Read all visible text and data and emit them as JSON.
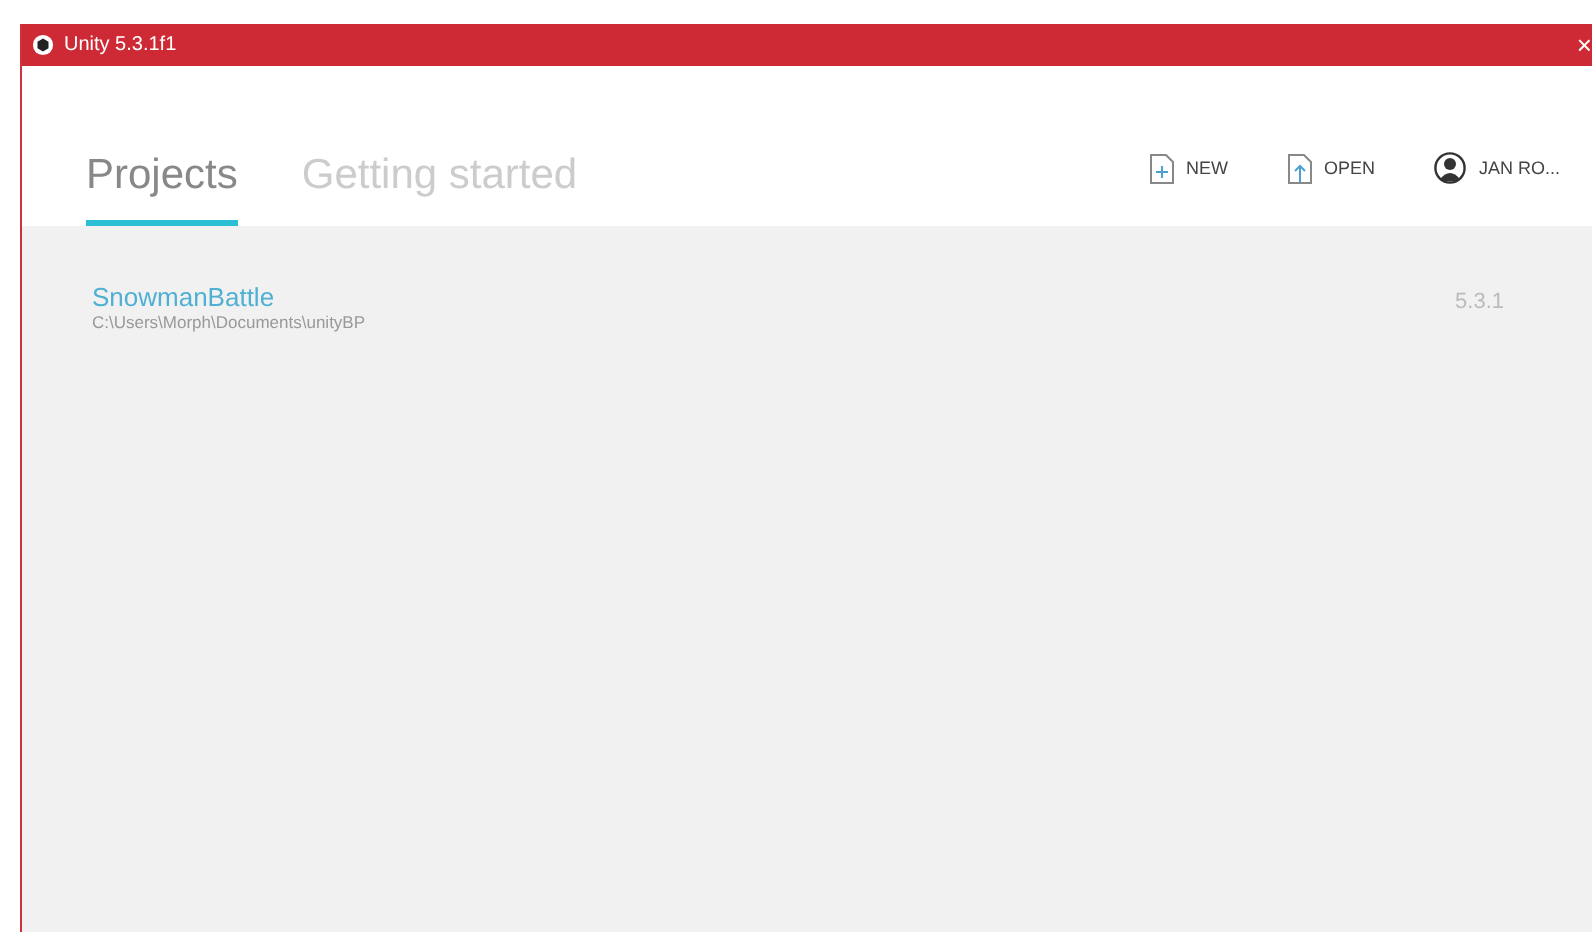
{
  "window": {
    "title": "Unity 5.3.1f1",
    "close": "×"
  },
  "tabs": [
    {
      "label": "Projects",
      "selected": true
    },
    {
      "label": "Getting started",
      "selected": false
    }
  ],
  "actions": [
    {
      "kind": "new",
      "label": "NEW"
    },
    {
      "kind": "open",
      "label": "OPEN"
    },
    {
      "kind": "account",
      "label": "JAN RO..."
    }
  ],
  "projects": [
    {
      "name": "SnowmanBattle",
      "path": "C:\\Users\\Morph\\Documents\\unityBP",
      "version": "5.3.1"
    }
  ]
}
